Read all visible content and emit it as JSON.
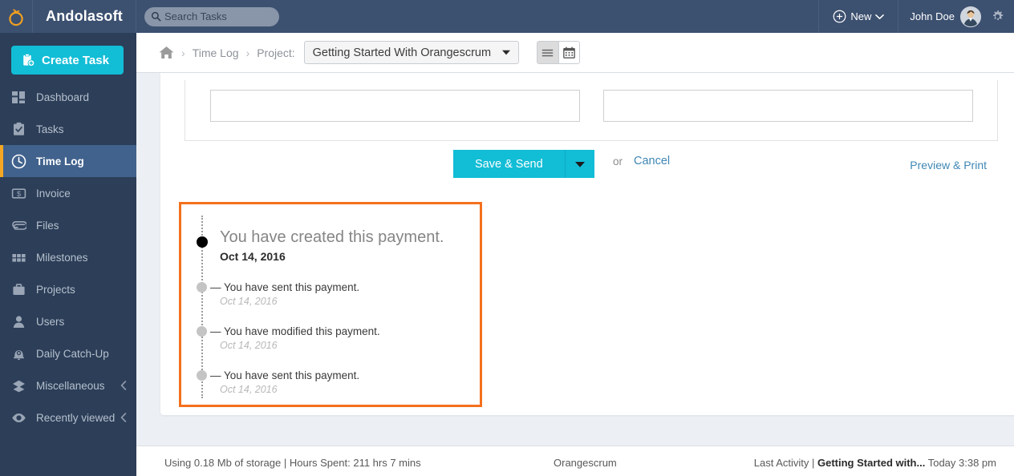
{
  "topbar": {
    "logo_icon": "orange-fruit-logo",
    "brand": "Andolasoft",
    "search": {
      "placeholder": "Search Tasks",
      "value": "",
      "icon": "search-icon"
    },
    "new_button": {
      "label": "New",
      "icon": "plus-circle-icon",
      "caret_icon": "chevron-down-icon"
    },
    "user": {
      "name": "John Doe",
      "avatar_icon": "user-avatar"
    },
    "settings_icon": "gear-icon"
  },
  "sidebar": {
    "create_task": {
      "label": "Create Task",
      "icon": "clipboard-plus-icon"
    },
    "items": [
      {
        "label": "Dashboard",
        "icon": "dashboard-grid-icon",
        "active": false,
        "chevron": false
      },
      {
        "label": "Tasks",
        "icon": "clipboard-check-icon",
        "active": false,
        "chevron": false
      },
      {
        "label": "Time Log",
        "icon": "clock-icon",
        "active": true,
        "chevron": false
      },
      {
        "label": "Invoice",
        "icon": "invoice-dollar-icon",
        "active": false,
        "chevron": false
      },
      {
        "label": "Files",
        "icon": "paperclip-icon",
        "active": false,
        "chevron": false
      },
      {
        "label": "Milestones",
        "icon": "milestones-grid-icon",
        "active": false,
        "chevron": false
      },
      {
        "label": "Projects",
        "icon": "briefcase-icon",
        "active": false,
        "chevron": false
      },
      {
        "label": "Users",
        "icon": "person-icon",
        "active": false,
        "chevron": false
      },
      {
        "label": "Daily Catch-Up",
        "icon": "bell-plus-icon",
        "active": false,
        "chevron": false
      },
      {
        "label": "Miscellaneous",
        "icon": "layers-icon",
        "active": false,
        "chevron": true
      },
      {
        "label": "Recently viewed",
        "icon": "eye-icon",
        "active": false,
        "chevron": true
      }
    ]
  },
  "breadcrumb": {
    "home_icon": "home-icon",
    "separator": "›",
    "time_log": "Time Log",
    "project_label": "Project:",
    "project_selected": "Getting Started With Orangescrum",
    "project_caret_icon": "caret-down-icon",
    "view_toggle": {
      "list": {
        "icon": "list-view-icon",
        "selected": false
      },
      "calendar": {
        "icon": "calendar-view-icon",
        "selected": true
      }
    }
  },
  "form": {
    "note_left": {
      "value": "",
      "placeholder": ""
    },
    "note_right": {
      "value": "",
      "placeholder": ""
    }
  },
  "actions": {
    "save_send": {
      "label": "Save & Send",
      "caret_icon": "caret-down-icon"
    },
    "or": "or",
    "cancel": "Cancel",
    "preview_print": "Preview & Print"
  },
  "activity": {
    "highlight_color": "#f4701d",
    "entries": [
      {
        "title": "You have created this payment.",
        "date": "Oct 14, 2016",
        "primary": true
      },
      {
        "title": "— You have sent this payment.",
        "date": "Oct 14, 2016",
        "primary": false
      },
      {
        "title": "— You have modified this payment.",
        "date": "Oct 14, 2016",
        "primary": false
      },
      {
        "title": "— You have sent this payment.",
        "date": "Oct 14, 2016",
        "primary": false
      }
    ]
  },
  "footer": {
    "left": "Using 0.18 Mb of storage | Hours Spent: 211 hrs 7 mins",
    "center": "Orangescrum",
    "right_prefix": "Last Activity | ",
    "right_bold": "Getting Started with...",
    "right_suffix": " Today 3:38 pm"
  },
  "colors": {
    "topbar": "#3c5070",
    "sidebar": "#2c3e58",
    "accent_cyan": "#12bdd6",
    "active_nav": "#41628d",
    "active_marker": "#f5a623",
    "highlight_orange": "#f4701d",
    "link_blue": "#3f87b5"
  }
}
